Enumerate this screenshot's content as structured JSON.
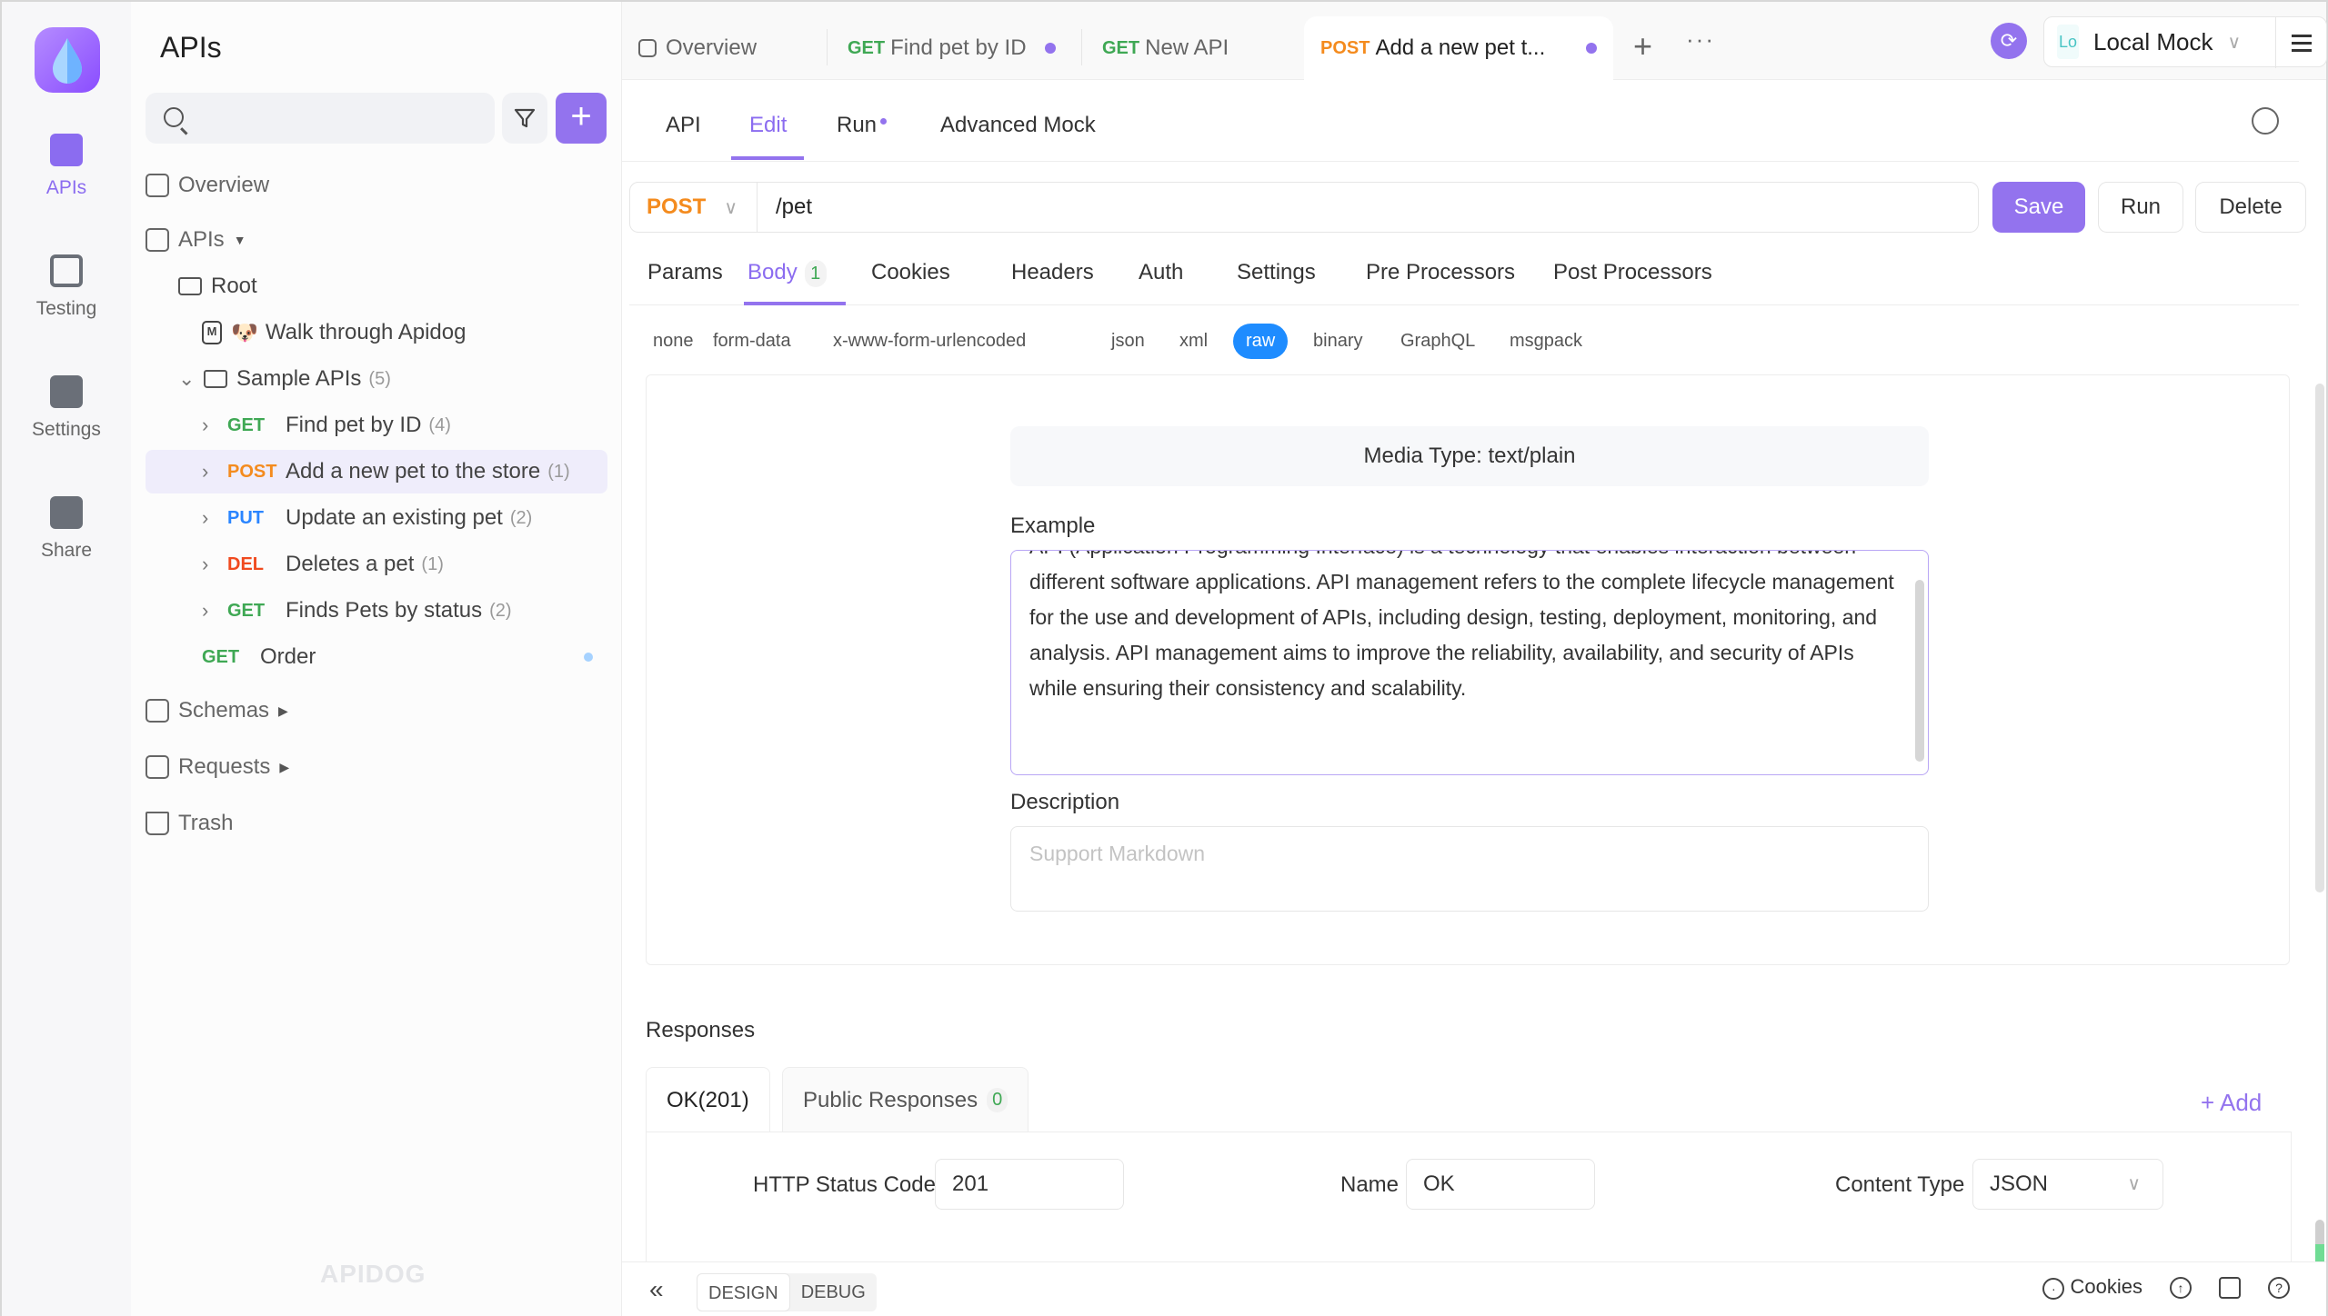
{
  "rail": {
    "items": [
      {
        "label": "APIs",
        "icon": "apis-icon",
        "active": true
      },
      {
        "label": "Testing",
        "icon": "testing-icon"
      },
      {
        "label": "Settings",
        "icon": "settings-icon"
      },
      {
        "label": "Share",
        "icon": "share-icon"
      }
    ]
  },
  "sidebar": {
    "title": "APIs",
    "search_placeholder": "",
    "overview": "Overview",
    "apis": "APIs",
    "root": "Root",
    "walkthrough": "Walk through Apidog",
    "walkthrough_emoji": "🐶",
    "sample_folder": {
      "label": "Sample APIs",
      "count": "(5)"
    },
    "endpoints": [
      {
        "method": "GET",
        "label": "Find pet by ID",
        "count": "(4)"
      },
      {
        "method": "POST",
        "label": "Add a new pet to the store",
        "count": "(1)",
        "selected": true
      },
      {
        "method": "PUT",
        "label": "Update an existing pet",
        "count": "(2)"
      },
      {
        "method": "DEL",
        "label": "Deletes a pet",
        "count": "(1)"
      },
      {
        "method": "GET",
        "label": "Finds Pets by status",
        "count": "(2)"
      }
    ],
    "order": {
      "method": "GET",
      "label": "Order"
    },
    "schemas": "Schemas",
    "requests": "Requests",
    "trash": "Trash",
    "watermark": "APIDOG"
  },
  "tabs": {
    "items": [
      {
        "method": "",
        "label": "Overview"
      },
      {
        "method": "GET",
        "label": "Find pet by ID",
        "unsaved": true
      },
      {
        "method": "GET",
        "label": "New API"
      },
      {
        "method": "POST",
        "label": "Add a new pet t...",
        "unsaved": true,
        "active": true
      }
    ],
    "more": "···"
  },
  "environment": {
    "badge": "Lo",
    "name": "Local Mock"
  },
  "subtabs": [
    "API",
    "Edit",
    "Run",
    "Advanced Mock"
  ],
  "active_subtab": "Edit",
  "request": {
    "method": "POST",
    "path": "/pet",
    "save": "Save",
    "run": "Run",
    "delete": "Delete"
  },
  "request_tabs": [
    {
      "label": "Params"
    },
    {
      "label": "Body",
      "badge": "1",
      "active": true
    },
    {
      "label": "Cookies"
    },
    {
      "label": "Headers"
    },
    {
      "label": "Auth"
    },
    {
      "label": "Settings"
    },
    {
      "label": "Pre Processors"
    },
    {
      "label": "Post Processors"
    }
  ],
  "body_types": [
    "none",
    "form-data",
    "x-www-form-urlencoded",
    "json",
    "xml",
    "raw",
    "binary",
    "GraphQL",
    "msgpack"
  ],
  "body_type_selected": "raw",
  "body": {
    "media_type": "Media Type: text/plain",
    "example_label": "Example",
    "example_text": "API (Application Programming Interface) is a technology that enables interaction between different software applications. API management refers to the complete lifecycle management for the use and development of APIs, including design, testing, deployment, monitoring, and analysis. API management aims to improve the reliability, availability, and security of APIs while ensuring their consistency and scalability.",
    "description_label": "Description",
    "description_placeholder": "Support Markdown"
  },
  "responses": {
    "title": "Responses",
    "tabs": [
      {
        "label": "OK(201)",
        "active": true
      },
      {
        "label": "Public Responses",
        "badge": "0"
      }
    ],
    "add": "+ Add",
    "status_code_label": "HTTP Status Code",
    "status_code": "201",
    "name_label": "Name",
    "name": "OK",
    "content_type_label": "Content Type",
    "content_type": "JSON"
  },
  "footer": {
    "modes": [
      "DESIGN",
      "DEBUG"
    ],
    "active_mode": "DESIGN",
    "cookies": "Cookies"
  },
  "colors": {
    "accent": "#9373ee",
    "get": "#3fa854",
    "post": "#f48b1e",
    "put": "#2a85ff",
    "delete": "#f04a1f",
    "raw_pill": "#1e8cff",
    "annotation_arrow": "#f04a47"
  }
}
